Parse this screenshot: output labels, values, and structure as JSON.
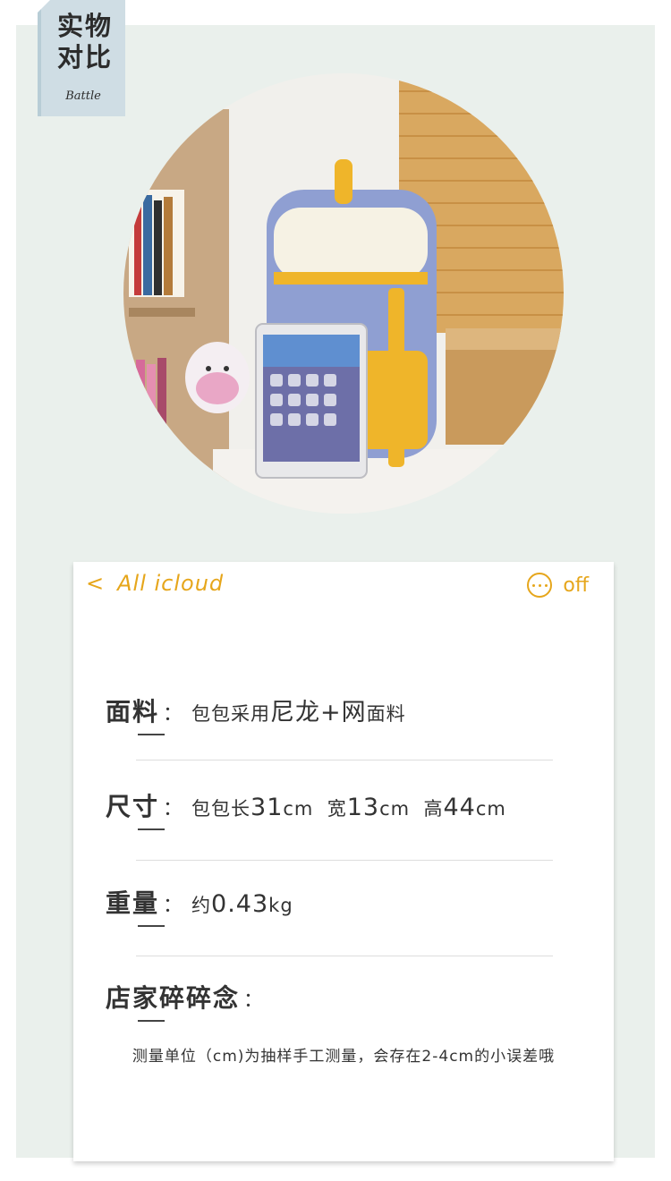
{
  "corner_tab": {
    "title": "实物对比",
    "subtitle": "Battle"
  },
  "photo": {
    "alt": "backpack-with-tablet"
  },
  "nav": {
    "back_label": "All icloud",
    "more_label": "off"
  },
  "rows": [
    {
      "key": "面料",
      "colon": "：",
      "value": "包包采用",
      "highlight": "尼龙+网",
      "suffix": "面料"
    },
    {
      "key": "尺寸",
      "colon": "：",
      "value_parts": [
        "包包长",
        "31",
        "cm  宽",
        "13",
        "cm  高",
        "44",
        "cm"
      ]
    },
    {
      "key": "重量",
      "colon": "：",
      "value_parts": [
        "约",
        "0.43",
        "kg"
      ]
    },
    {
      "key": "店家碎碎念",
      "colon": "："
    }
  ],
  "note": "测量单位（cm)为抽样手工测量，会存在2-4cm的小误差哦",
  "colors": {
    "accent": "#e6a61b",
    "panel": "#eaf0ec",
    "tab": "#cfdde4"
  }
}
